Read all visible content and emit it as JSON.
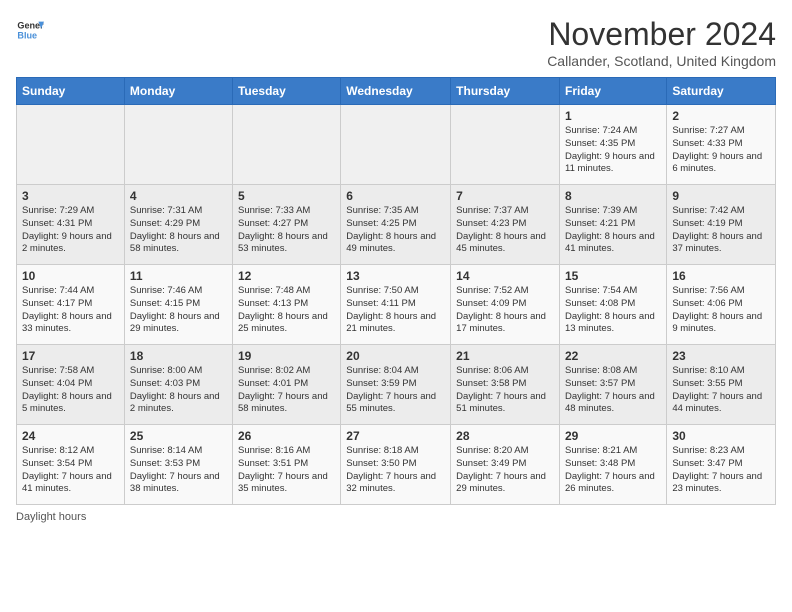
{
  "logo": {
    "text_general": "General",
    "text_blue": "Blue"
  },
  "header": {
    "month_title": "November 2024",
    "location": "Callander, Scotland, United Kingdom"
  },
  "columns": [
    "Sunday",
    "Monday",
    "Tuesday",
    "Wednesday",
    "Thursday",
    "Friday",
    "Saturday"
  ],
  "footer": {
    "daylight_note": "Daylight hours"
  },
  "weeks": [
    {
      "days": [
        {
          "num": "",
          "info": ""
        },
        {
          "num": "",
          "info": ""
        },
        {
          "num": "",
          "info": ""
        },
        {
          "num": "",
          "info": ""
        },
        {
          "num": "",
          "info": ""
        },
        {
          "num": "1",
          "info": "Sunrise: 7:24 AM\nSunset: 4:35 PM\nDaylight: 9 hours and 11 minutes."
        },
        {
          "num": "2",
          "info": "Sunrise: 7:27 AM\nSunset: 4:33 PM\nDaylight: 9 hours and 6 minutes."
        }
      ]
    },
    {
      "days": [
        {
          "num": "3",
          "info": "Sunrise: 7:29 AM\nSunset: 4:31 PM\nDaylight: 9 hours and 2 minutes."
        },
        {
          "num": "4",
          "info": "Sunrise: 7:31 AM\nSunset: 4:29 PM\nDaylight: 8 hours and 58 minutes."
        },
        {
          "num": "5",
          "info": "Sunrise: 7:33 AM\nSunset: 4:27 PM\nDaylight: 8 hours and 53 minutes."
        },
        {
          "num": "6",
          "info": "Sunrise: 7:35 AM\nSunset: 4:25 PM\nDaylight: 8 hours and 49 minutes."
        },
        {
          "num": "7",
          "info": "Sunrise: 7:37 AM\nSunset: 4:23 PM\nDaylight: 8 hours and 45 minutes."
        },
        {
          "num": "8",
          "info": "Sunrise: 7:39 AM\nSunset: 4:21 PM\nDaylight: 8 hours and 41 minutes."
        },
        {
          "num": "9",
          "info": "Sunrise: 7:42 AM\nSunset: 4:19 PM\nDaylight: 8 hours and 37 minutes."
        }
      ]
    },
    {
      "days": [
        {
          "num": "10",
          "info": "Sunrise: 7:44 AM\nSunset: 4:17 PM\nDaylight: 8 hours and 33 minutes."
        },
        {
          "num": "11",
          "info": "Sunrise: 7:46 AM\nSunset: 4:15 PM\nDaylight: 8 hours and 29 minutes."
        },
        {
          "num": "12",
          "info": "Sunrise: 7:48 AM\nSunset: 4:13 PM\nDaylight: 8 hours and 25 minutes."
        },
        {
          "num": "13",
          "info": "Sunrise: 7:50 AM\nSunset: 4:11 PM\nDaylight: 8 hours and 21 minutes."
        },
        {
          "num": "14",
          "info": "Sunrise: 7:52 AM\nSunset: 4:09 PM\nDaylight: 8 hours and 17 minutes."
        },
        {
          "num": "15",
          "info": "Sunrise: 7:54 AM\nSunset: 4:08 PM\nDaylight: 8 hours and 13 minutes."
        },
        {
          "num": "16",
          "info": "Sunrise: 7:56 AM\nSunset: 4:06 PM\nDaylight: 8 hours and 9 minutes."
        }
      ]
    },
    {
      "days": [
        {
          "num": "17",
          "info": "Sunrise: 7:58 AM\nSunset: 4:04 PM\nDaylight: 8 hours and 5 minutes."
        },
        {
          "num": "18",
          "info": "Sunrise: 8:00 AM\nSunset: 4:03 PM\nDaylight: 8 hours and 2 minutes."
        },
        {
          "num": "19",
          "info": "Sunrise: 8:02 AM\nSunset: 4:01 PM\nDaylight: 7 hours and 58 minutes."
        },
        {
          "num": "20",
          "info": "Sunrise: 8:04 AM\nSunset: 3:59 PM\nDaylight: 7 hours and 55 minutes."
        },
        {
          "num": "21",
          "info": "Sunrise: 8:06 AM\nSunset: 3:58 PM\nDaylight: 7 hours and 51 minutes."
        },
        {
          "num": "22",
          "info": "Sunrise: 8:08 AM\nSunset: 3:57 PM\nDaylight: 7 hours and 48 minutes."
        },
        {
          "num": "23",
          "info": "Sunrise: 8:10 AM\nSunset: 3:55 PM\nDaylight: 7 hours and 44 minutes."
        }
      ]
    },
    {
      "days": [
        {
          "num": "24",
          "info": "Sunrise: 8:12 AM\nSunset: 3:54 PM\nDaylight: 7 hours and 41 minutes."
        },
        {
          "num": "25",
          "info": "Sunrise: 8:14 AM\nSunset: 3:53 PM\nDaylight: 7 hours and 38 minutes."
        },
        {
          "num": "26",
          "info": "Sunrise: 8:16 AM\nSunset: 3:51 PM\nDaylight: 7 hours and 35 minutes."
        },
        {
          "num": "27",
          "info": "Sunrise: 8:18 AM\nSunset: 3:50 PM\nDaylight: 7 hours and 32 minutes."
        },
        {
          "num": "28",
          "info": "Sunrise: 8:20 AM\nSunset: 3:49 PM\nDaylight: 7 hours and 29 minutes."
        },
        {
          "num": "29",
          "info": "Sunrise: 8:21 AM\nSunset: 3:48 PM\nDaylight: 7 hours and 26 minutes."
        },
        {
          "num": "30",
          "info": "Sunrise: 8:23 AM\nSunset: 3:47 PM\nDaylight: 7 hours and 23 minutes."
        }
      ]
    }
  ]
}
